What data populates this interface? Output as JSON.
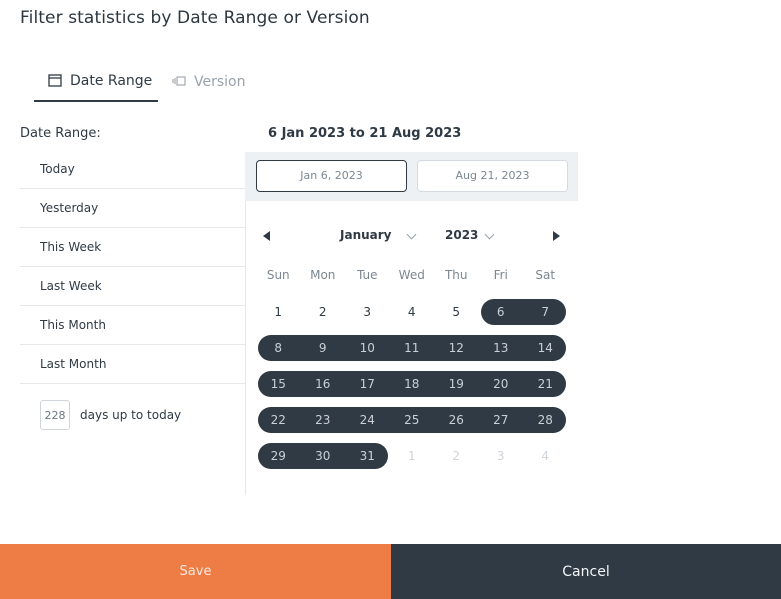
{
  "dialog": {
    "title": "Filter statistics by Date Range or Version"
  },
  "tabs": [
    {
      "label": "Date Range",
      "icon": "calendar-icon",
      "active": true
    },
    {
      "label": "Version",
      "icon": "version-icon",
      "active": false
    }
  ],
  "date_range": {
    "label": "Date Range:",
    "summary": "6 Jan 2023 to 21 Aug 2023",
    "start_input": "Jan 6, 2023",
    "end_input": "Aug 21, 2023"
  },
  "presets": [
    "Today",
    "Yesterday",
    "This Week",
    "Last Week",
    "This Month",
    "Last Month"
  ],
  "days_up_to_today": {
    "value": "228",
    "label": "days up to today"
  },
  "calendar": {
    "month": "January",
    "year": "2023",
    "weekdays": [
      "Sun",
      "Mon",
      "Tue",
      "Wed",
      "Thu",
      "Fri",
      "Sat"
    ],
    "weeks": [
      [
        "1",
        "2",
        "3",
        "4",
        "5",
        "6",
        "7"
      ],
      [
        "8",
        "9",
        "10",
        "11",
        "12",
        "13",
        "14"
      ],
      [
        "15",
        "16",
        "17",
        "18",
        "19",
        "20",
        "21"
      ],
      [
        "22",
        "23",
        "24",
        "25",
        "26",
        "27",
        "28"
      ],
      [
        "29",
        "30",
        "31",
        "1",
        "2",
        "3",
        "4"
      ]
    ],
    "selected_from_day": 6,
    "selected_to_day": 31
  },
  "colors": {
    "accent": "#ed7d45",
    "dark": "#2f3a44"
  },
  "footer": {
    "save_label": "Save",
    "cancel_label": "Cancel"
  }
}
